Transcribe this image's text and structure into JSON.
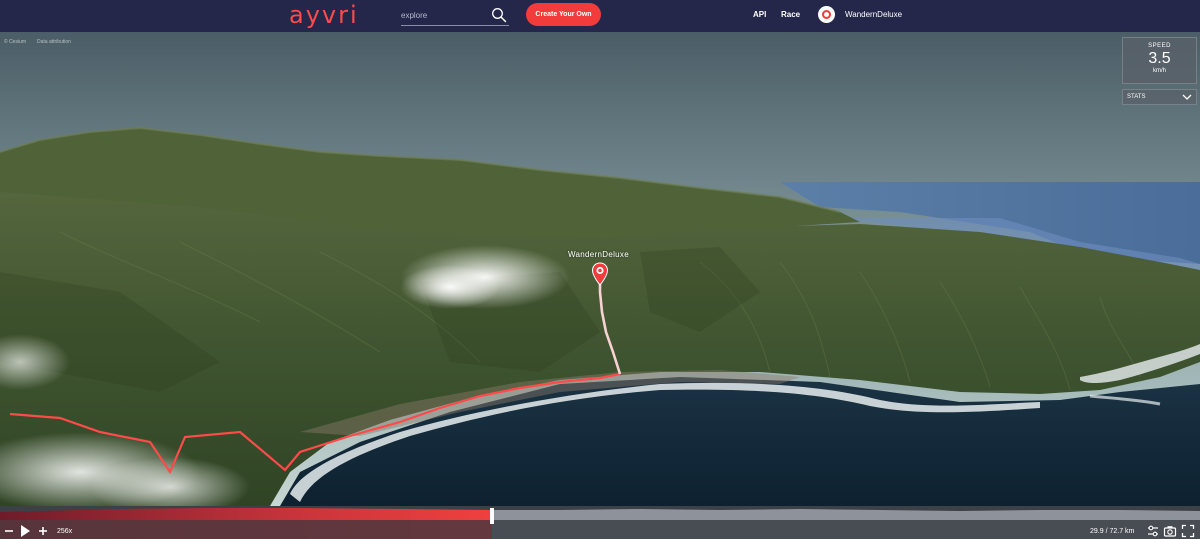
{
  "app": {
    "logo": "ayvri"
  },
  "nav": {
    "search_placeholder": "explore",
    "create_label": "Create Your Own",
    "api_label": "API",
    "race_label": "Race",
    "username": "WandernDeluxe"
  },
  "map": {
    "attribution_1": "© Cesium",
    "attribution_2": "Data attribution",
    "marker_label": "WandernDeluxe"
  },
  "speed_panel": {
    "label": "SPEED",
    "value": "3.5",
    "unit": "km/h"
  },
  "stats_panel": {
    "label": "STATS"
  },
  "playback": {
    "speed_multiplier": "256x",
    "distance": "29.9 / 72.7 km",
    "progress": 0.41
  },
  "colors": {
    "accent": "#f23b3b",
    "nav_bg": "#24264a",
    "track": "#ff4a4a"
  },
  "icons": [
    "search-icon",
    "minus-icon",
    "play-icon",
    "plus-icon",
    "settings-sliders-icon",
    "camera-icon",
    "fullscreen-icon",
    "chevron-down-icon"
  ]
}
